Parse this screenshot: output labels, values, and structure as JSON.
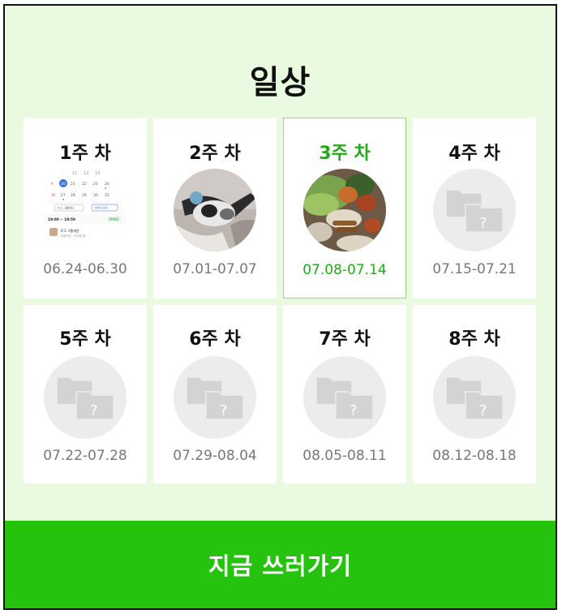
{
  "page": {
    "title": "일상"
  },
  "weeks": [
    {
      "label": "1주 차",
      "dates": "06.24-06.30",
      "thumb": "calendar-screenshot"
    },
    {
      "label": "2주 차",
      "dates": "07.01-07.07",
      "thumb": "photo"
    },
    {
      "label": "3주 차",
      "dates": "07.08-07.14",
      "thumb": "food-photo",
      "selected": true
    },
    {
      "label": "4주 차",
      "dates": "07.15-07.21",
      "thumb": "empty-folder-icon"
    },
    {
      "label": "5주 차",
      "dates": "07.22-07.28",
      "thumb": "empty-folder-icon"
    },
    {
      "label": "6주 차",
      "dates": "07.29-08.04",
      "thumb": "empty-folder-icon"
    },
    {
      "label": "7주 차",
      "dates": "08.05-08.11",
      "thumb": "empty-folder-icon"
    },
    {
      "label": "8주 차",
      "dates": "08.12-08.18",
      "thumb": "empty-folder-icon"
    }
  ],
  "thumb_1": {
    "cal_days_row1": [
      "11",
      "12",
      "13"
    ],
    "cal_days_row2": [
      "20",
      "21",
      "22",
      "23",
      "24"
    ],
    "cal_days_row3": [
      "27",
      "28",
      "29",
      "30",
      "31"
    ],
    "chip1": "4:1 그룹에딘",
    "chip2": "번역(다온)",
    "time": "19:00 ~ 19:50",
    "badge": "예약완료",
    "name": "4:1 그룹세션",
    "sub": "마음챙김 · 이정일 쌤"
  },
  "cta": {
    "label": "지금 쓰러가기"
  },
  "colors": {
    "background": "#eafae0",
    "accent": "#25c20e",
    "selected_text": "#22a81a"
  }
}
